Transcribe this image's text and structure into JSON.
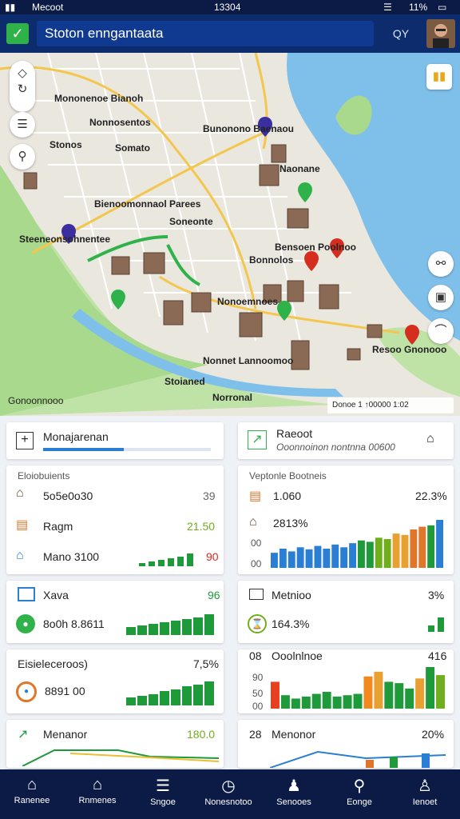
{
  "status": {
    "carrier": "Mecoot",
    "time": "13304",
    "battery": "11%"
  },
  "app": {
    "title": "Stoton enngantaata",
    "right_label": "QY"
  },
  "map": {
    "labels": [
      "Mononenoe Bianoh",
      "Nonnosentos",
      "Stonos",
      "Somato",
      "Bunonono Baenaou",
      "Naonane",
      "Bienoomonnaol Parees",
      "Soneonte",
      "Steeneonsohnentee",
      "Bensoen Poolnoo",
      "Bonnolos",
      "Nonoemnoes",
      "Resoo Gnonooo",
      "Nonnet Lannoomoo",
      "Stoianed",
      "Norronal"
    ],
    "corner": "Gonoonnooo",
    "scale": "Donoe    1    ↑00000    1:02"
  },
  "panels": {
    "left_header": {
      "title": "Monajarenan"
    },
    "right_header": {
      "title": "Raeoot",
      "subtitle": "Ooonnoinon nontnna 00600"
    },
    "left_card1": {
      "title": "Eloiobuients",
      "rows": [
        {
          "label": "5o5e0o30",
          "value": "39",
          "vcolor": "#666"
        },
        {
          "label": "Ragm",
          "value": "21.50",
          "vcolor": "#6fae1c"
        },
        {
          "label": "Mano 3100",
          "value": "90",
          "vcolor": "#d62e1e"
        }
      ]
    },
    "right_card1": {
      "title": "Veptonle Bootneis",
      "rows": [
        {
          "label": "1.060",
          "value": "22.3%"
        },
        {
          "label": "2813%",
          "value": ""
        }
      ],
      "axis": [
        "00",
        "00"
      ],
      "chart_data": {
        "type": "bar",
        "categories": [
          "1",
          "2",
          "3",
          "4",
          "5",
          "6",
          "7",
          "8",
          "9",
          "10",
          "11",
          "12",
          "13",
          "14",
          "15",
          "16",
          "17",
          "18",
          "19",
          "20"
        ],
        "values": [
          22,
          28,
          24,
          30,
          27,
          32,
          28,
          34,
          30,
          36,
          40,
          38,
          44,
          42,
          50,
          48,
          56,
          60,
          62,
          70
        ]
      }
    },
    "left_card2": {
      "rows": [
        {
          "label": "Xava",
          "value": "96"
        },
        {
          "label": "8o0h 8.8611",
          "value": ""
        }
      ]
    },
    "right_card2": {
      "rows": [
        {
          "label": "Metnioo",
          "value": "3%"
        },
        {
          "label": "164.3%",
          "value": ""
        }
      ]
    },
    "left_card3": {
      "title": "Eisieleceroos)",
      "value": "7,5%",
      "row": "8891 00"
    },
    "right_card3": {
      "title": "Ooolnlnoe",
      "prefix": "08",
      "value": "416",
      "axis": [
        "90",
        "50",
        "00"
      ],
      "chart_data": {
        "type": "bar",
        "values": [
          40,
          20,
          15,
          18,
          22,
          25,
          18,
          20,
          22,
          48,
          55,
          40,
          38,
          30,
          45,
          62,
          50
        ]
      }
    },
    "left_card4": {
      "title": "Menanor",
      "value": "180.0"
    },
    "right_card4": {
      "prefix": "28",
      "title": "Menonor",
      "value": "20%"
    }
  },
  "nav": [
    {
      "icon": "home",
      "label": "Ranenee"
    },
    {
      "icon": "building",
      "label": "Rnmenes"
    },
    {
      "icon": "list",
      "label": "Sngoe"
    },
    {
      "icon": "clock",
      "label": "Nonesnotoo"
    },
    {
      "icon": "user",
      "label": "Senooes"
    },
    {
      "icon": "search",
      "label": "Eonge"
    },
    {
      "icon": "profile",
      "label": "Ienoet"
    }
  ]
}
